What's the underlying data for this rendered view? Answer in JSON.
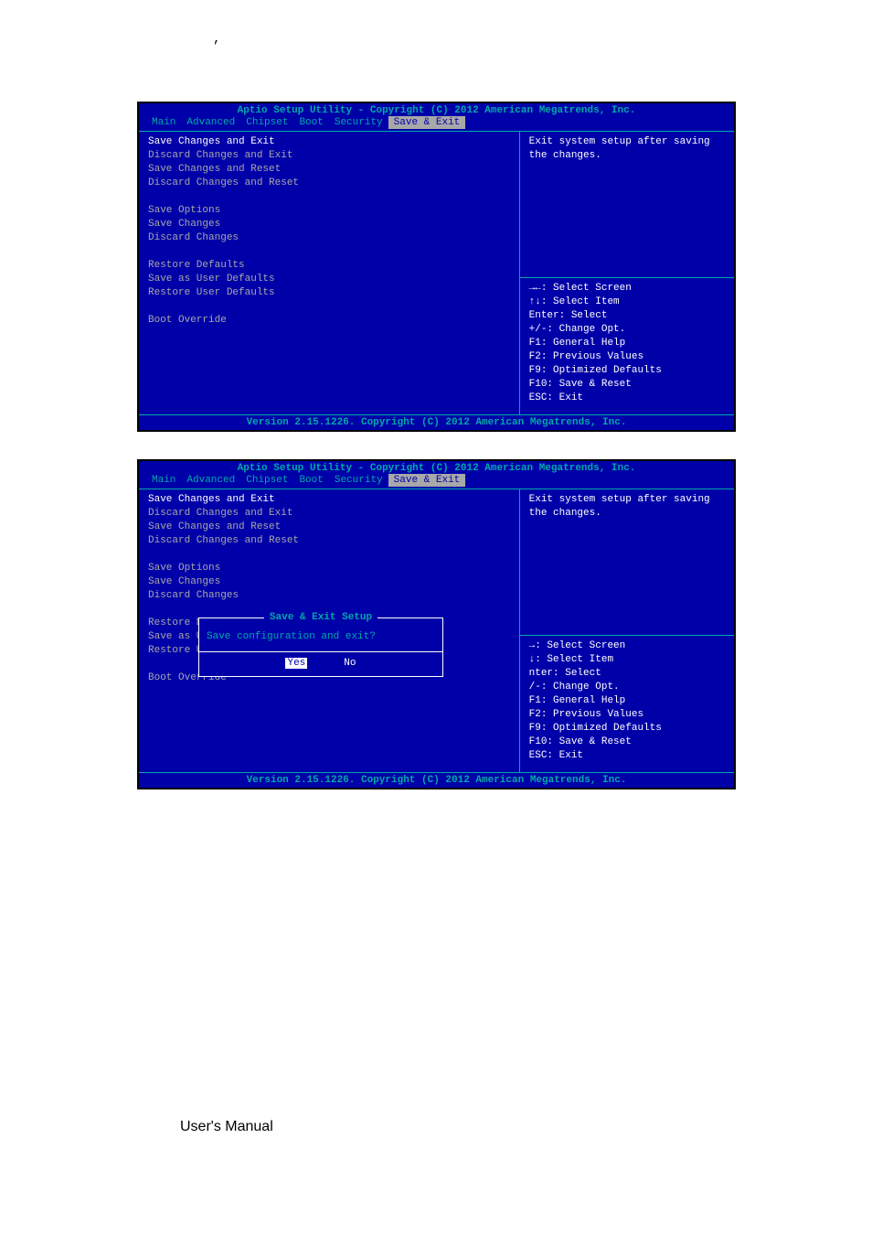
{
  "comma": ",",
  "bios1": {
    "title": "Aptio Setup Utility - Copyright (C) 2012 American Megatrends, Inc.",
    "menu": [
      "Main",
      "Advanced",
      "Chipset",
      "Boot",
      "Security",
      "Save & Exit"
    ],
    "active_menu_idx": 5,
    "left_groups": [
      [
        "Save Changes and Exit",
        "Discard Changes and Exit",
        "Save Changes and Reset",
        "Discard Changes and Reset"
      ],
      [
        "Save Options",
        "Save Changes",
        "Discard Changes"
      ],
      [
        "Restore Defaults",
        "Save as User Defaults",
        "Restore User Defaults"
      ],
      [
        "Boot Override"
      ]
    ],
    "selected": "Save Changes and Exit",
    "help_top": [
      "Exit system setup after saving",
      "the changes."
    ],
    "help_bottom": [
      "→←: Select Screen",
      "↑↓: Select Item",
      "Enter: Select",
      "+/-: Change Opt.",
      "F1: General Help",
      "F2: Previous Values",
      "F9: Optimized Defaults",
      "F10: Save & Reset",
      "ESC: Exit"
    ],
    "footer": "Version 2.15.1226. Copyright (C) 2012 American Megatrends, Inc."
  },
  "bios2": {
    "title": "Aptio Setup Utility - Copyright (C) 2012 American Megatrends, Inc.",
    "menu": [
      "Main",
      "Advanced",
      "Chipset",
      "Boot",
      "Security",
      "Save & Exit"
    ],
    "active_menu_idx": 5,
    "left_groups": [
      [
        "Save Changes and Exit",
        "Discard Changes and Exit",
        "Save Changes and Reset",
        "Discard Changes and Reset"
      ],
      [
        "Save Options",
        "Save Changes",
        "Discard Changes"
      ],
      [
        "Restore Defaults",
        "Save as User Defaults",
        "Restore User Defaults"
      ],
      [
        "Boot Override"
      ]
    ],
    "selected": "Save Changes and Exit",
    "help_top": [
      "Exit system setup after saving",
      "the changes."
    ],
    "help_bottom": [
      "→: Select Screen",
      "↓: Select Item",
      "nter: Select",
      "/-: Change Opt.",
      "F1: General Help",
      "F2: Previous Values",
      "F9: Optimized Defaults",
      "F10: Save & Reset",
      "ESC: Exit"
    ],
    "footer": "Version 2.15.1226. Copyright (C) 2012 American Megatrends, Inc.",
    "dialog": {
      "title": "Save & Exit Setup",
      "text": "Save configuration and exit?",
      "yes": "Yes",
      "no": "No"
    }
  },
  "user_manual": "User's Manual"
}
